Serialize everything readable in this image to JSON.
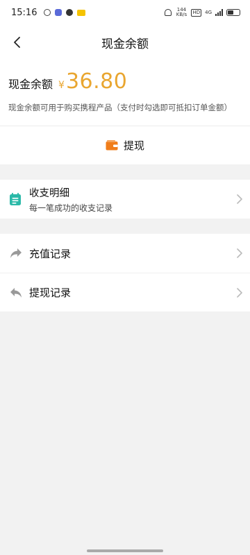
{
  "status_bar": {
    "time": "15:16",
    "speed": "144 KB/s",
    "hd": "HD",
    "network": "4G"
  },
  "nav": {
    "title": "现金余额"
  },
  "balance": {
    "label": "现金余额",
    "currency_symbol": "¥",
    "amount": "36.80",
    "description": "现金余额可用于购买携程产品（支付时勾选即可抵扣订单金额）"
  },
  "withdraw": {
    "label": "提现",
    "icon": "wallet-icon"
  },
  "details": {
    "title": "收支明细",
    "subtitle": "每一笔成功的收支记录",
    "icon": "notepad-icon"
  },
  "records": [
    {
      "label": "充值记录",
      "icon": "forward-arrow-icon"
    },
    {
      "label": "提现记录",
      "icon": "reply-arrow-icon"
    }
  ],
  "colors": {
    "accent": "#e9a630",
    "wallet": "#f07d1a",
    "teal": "#2bb9a8"
  }
}
